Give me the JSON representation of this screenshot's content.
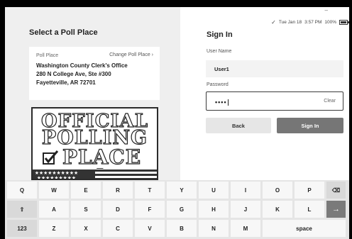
{
  "poll_panel": {
    "title": "Select a Poll Place",
    "card_label": "Poll Place",
    "change_link": "Change Poll Place ›",
    "name": "Washington County Clerk's Office",
    "address_line1": "280 N College Ave,  Ste #300",
    "address_line2": "Fayetteville, AR 72701",
    "sign_lines": [
      "OFFICIAL",
      "POLLING",
      "PLACE"
    ]
  },
  "status_bar": {
    "date": "Tue Jan 18",
    "time": "3:57 PM",
    "battery": "100%"
  },
  "signin": {
    "title": "Sign In",
    "username_label": "User Name",
    "username_value": "User1",
    "password_label": "Password",
    "password_value": "••••",
    "clear_label": "Clear",
    "back_label": "Back",
    "signin_label": "Sign In"
  },
  "keyboard": {
    "row1": [
      "Q",
      "W",
      "E",
      "R",
      "T",
      "Y",
      "U",
      "I",
      "O",
      "P"
    ],
    "row2": [
      "A",
      "S",
      "D",
      "F",
      "G",
      "H",
      "J",
      "K",
      "L"
    ],
    "row3": [
      "Z",
      "X",
      "C",
      "V",
      "B",
      "N",
      "M"
    ],
    "numbers_key": "123",
    "space_key": "space",
    "shift_icon": "shift-icon",
    "backspace_icon": "backspace-icon",
    "enter_icon": "enter-icon",
    "accent_color": "#7a7a7a"
  }
}
